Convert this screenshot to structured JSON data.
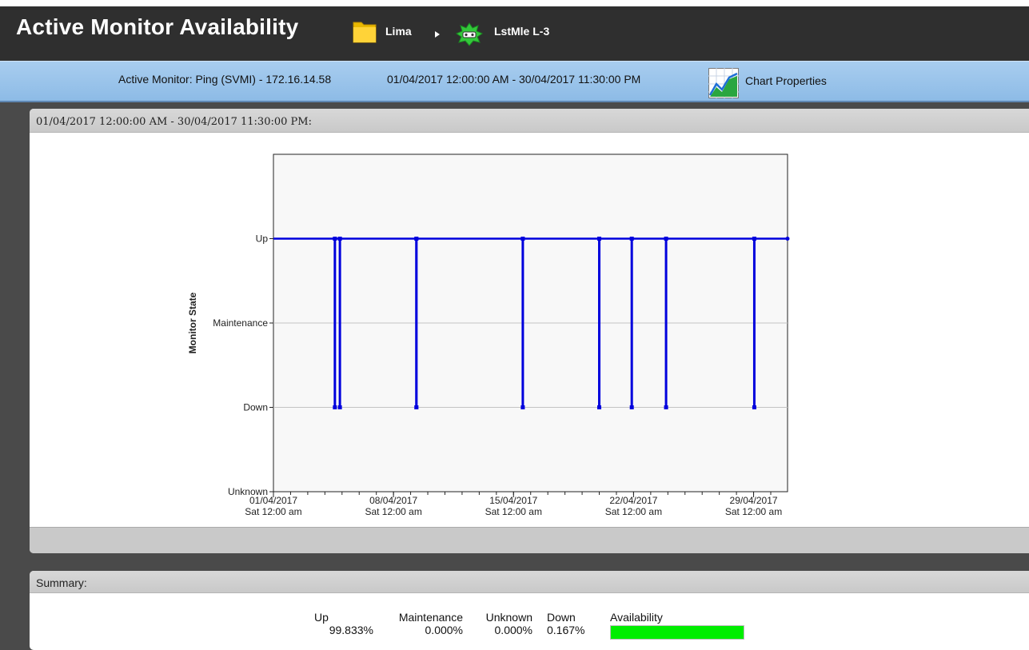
{
  "header": {
    "title": "Active Monitor Availability",
    "crumbs": [
      {
        "label": "Lima",
        "icon": "folder-icon"
      },
      {
        "label": "LstMle L-3",
        "icon": "device-status-icon"
      }
    ]
  },
  "info_bar": {
    "monitor": "Active Monitor: Ping (SVMI) - 172.16.14.58",
    "date_range": "01/04/2017 12:00:00 AM - 30/04/2017 11:30:00 PM",
    "chart_properties_label": "Chart Properties"
  },
  "chart_panel": {
    "heading": "01/04/2017 12:00:00 AM - 30/04/2017 11:30:00 PM:"
  },
  "chart_data": {
    "type": "line",
    "title": "",
    "xlabel": "",
    "ylabel": "Monitor State",
    "y_categories": [
      "Unknown",
      "Down",
      "Maintenance",
      "Up"
    ],
    "x_range": [
      "01/04/2017 00:00",
      "30/04/2017 23:30"
    ],
    "x_ticks": [
      {
        "date": "01/04/2017",
        "day": "Sat 12:00 am"
      },
      {
        "date": "08/04/2017",
        "day": "Sat 12:00 am"
      },
      {
        "date": "15/04/2017",
        "day": "Sat 12:00 am"
      },
      {
        "date": "22/04/2017",
        "day": "Sat 12:00 am"
      },
      {
        "date": "29/04/2017",
        "day": "Sat 12:00 am"
      }
    ],
    "baseline_state": "Up",
    "down_events": [
      {
        "start": "04/04/2017 14:00",
        "end": "04/04/2017 14:30"
      },
      {
        "start": "04/04/2017 21:00",
        "end": "04/04/2017 23:00"
      },
      {
        "start": "09/04/2017 08:00",
        "end": "09/04/2017 11:30"
      },
      {
        "start": "15/04/2017 13:00",
        "end": "15/04/2017 13:30"
      },
      {
        "start": "20/04/2017 00:00",
        "end": "20/04/2017 00:30"
      },
      {
        "start": "21/04/2017 21:30",
        "end": "21/04/2017 22:00"
      },
      {
        "start": "23/04/2017 21:30",
        "end": "23/04/2017 22:00"
      },
      {
        "start": "29/04/2017 01:00",
        "end": "29/04/2017 01:30"
      }
    ],
    "line_color": "#0000dd",
    "grid": true
  },
  "summary": {
    "heading": "Summary:",
    "up_label": "Up",
    "up_value": "99.833%",
    "maintenance_label": "Maintenance",
    "maintenance_value": "0.000%",
    "unknown_label": "Unknown",
    "unknown_value": "0.000%",
    "down_label": "Down",
    "down_value": "0.167%",
    "availability_label": "Availability",
    "availability_fraction": 0.99833,
    "availability_color": "#00ee00"
  }
}
